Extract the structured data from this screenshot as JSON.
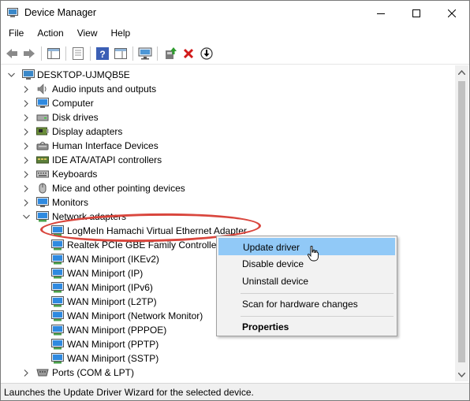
{
  "window": {
    "title": "Device Manager"
  },
  "menu": [
    "File",
    "Action",
    "View",
    "Help"
  ],
  "tree": {
    "root": "DESKTOP-UJMQB5E",
    "categories": [
      {
        "label": "Audio inputs and outputs",
        "icon": "speaker-icon"
      },
      {
        "label": "Computer",
        "icon": "computer-icon"
      },
      {
        "label": "Disk drives",
        "icon": "disk-drive-icon"
      },
      {
        "label": "Display adapters",
        "icon": "display-adapter-icon"
      },
      {
        "label": "Human Interface Devices",
        "icon": "hid-icon"
      },
      {
        "label": "IDE ATA/ATAPI controllers",
        "icon": "ide-controller-icon"
      },
      {
        "label": "Keyboards",
        "icon": "keyboard-icon"
      },
      {
        "label": "Mice and other pointing devices",
        "icon": "mouse-icon"
      },
      {
        "label": "Monitors",
        "icon": "monitor-icon"
      },
      {
        "label": "Network adapters",
        "icon": "network-adapter-icon",
        "expanded": true
      }
    ],
    "network_children": [
      "LogMeIn Hamachi Virtual Ethernet Adapter",
      "Realtek PCIe GBE Family Controller",
      "WAN Miniport (IKEv2)",
      "WAN Miniport (IP)",
      "WAN Miniport (IPv6)",
      "WAN Miniport (L2TP)",
      "WAN Miniport (Network Monitor)",
      "WAN Miniport (PPPOE)",
      "WAN Miniport (PPTP)",
      "WAN Miniport (SSTP)"
    ],
    "after": [
      {
        "label": "Ports (COM & LPT)",
        "icon": "port-icon"
      }
    ]
  },
  "context_menu": {
    "items": [
      {
        "label": "Update driver",
        "highlighted": true
      },
      {
        "label": "Disable device"
      },
      {
        "label": "Uninstall device"
      },
      {
        "label": "Scan for hardware changes"
      },
      {
        "label": "Properties",
        "bold": true
      }
    ]
  },
  "status": {
    "text": "Launches the Update Driver Wizard for the selected device."
  },
  "colors": {
    "highlight": "#91c9f7",
    "annotation": "#d9463d",
    "uninstall_red": "#d11a1a"
  }
}
